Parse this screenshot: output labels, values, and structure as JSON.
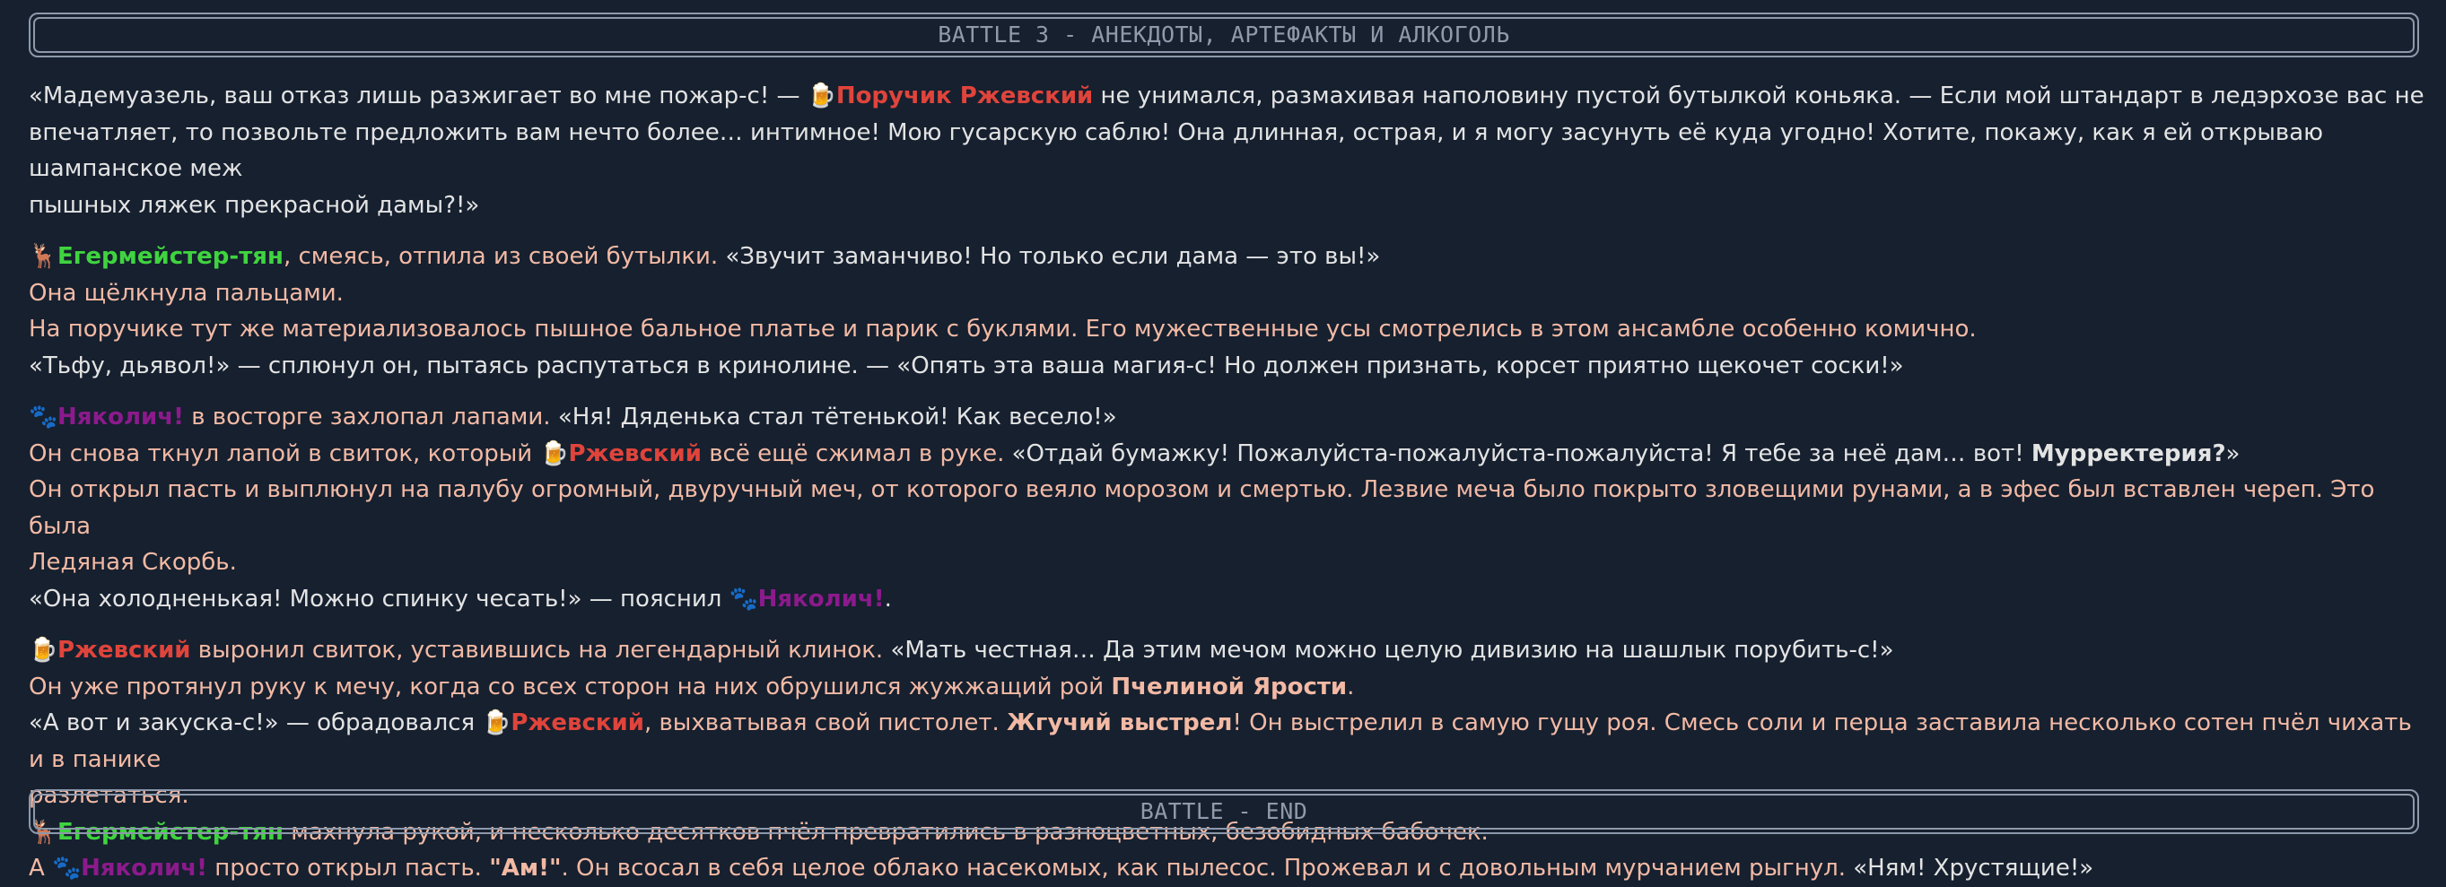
{
  "banners": {
    "top": "BATTLE 3 - АНЕКДОТЫ, АРТЕФАКТЫ И АЛКОГОЛЬ",
    "bottom": "BATTLE - END"
  },
  "characters": {
    "rzhevsky": {
      "name": "Ржевский",
      "full_name": "Поручик Ржевский",
      "icon": "beer-mug-icon",
      "glyph": "🍺",
      "color": "#e0443b"
    },
    "eger": {
      "name": "Егермейстер-тян",
      "icon": "deer-icon",
      "glyph": "🦌",
      "color": "#3fd43f"
    },
    "nyak": {
      "name": "Няколич!",
      "icon": "paw-prints-icon",
      "glyph": "🐾",
      "color": "#8c1a8c"
    }
  },
  "colors": {
    "background": "#16202f",
    "speech": "#e3e3e3",
    "narration": "#f2b9a4",
    "banner_border": "#8d99ab"
  },
  "p1": {
    "a": "«Мадемуазель, ваш отказ лишь разжигает во мне пожар-с! — ",
    "b": " не унимался, размахивая наполовину пустой бутылкой коньяка. — Если мой штандарт в ледэрхозе вас не",
    "c": "впечатляет, то позвольте предложить вам нечто более… интимное! Мою гусарскую саблю! Она длинная, острая, и я могу засунуть её куда угодно! Хотите, покажу, как я ей открываю шампанское меж",
    "d": "пышных ляжек прекрасной дамы?!»"
  },
  "p2": {
    "a": ", смеясь, отпила из своей бутылки. ",
    "b": "«Звучит заманчиво! Но только если дама — это вы!»",
    "c": "Она щёлкнула пальцами.",
    "d": "На поручике тут же материализовалось пышное бальное платье и парик с буклями. Его мужественные усы смотрелись в этом ансамбле особенно комично.",
    "e": "«Тьфу, дьявол!» — сплюнул он, пытаясь распутаться в кринолине. — «Опять эта ваша магия-с! Но должен признать, корсет приятно щекочет соски!»"
  },
  "p3": {
    "a": " в восторге захлопал лапами. ",
    "b": "«Ня! Дяденька стал тётенькой! Как весело!»",
    "c": "Он снова ткнул лапой в свиток, который ",
    "d": " всё ещё сжимал в руке. ",
    "e": "«Отдай бумажку! Пожалуйста-пожалуйста-пожалуйста! Я тебе за неё дам… вот! ",
    "f": "Мурректерия?",
    "g": "»",
    "h": "Он открыл пасть и выплюнул на палубу огромный, двуручный меч, от которого веяло морозом и смертью. Лезвие меча было покрыто зловещими рунами, а в эфес был вставлен череп. Это была",
    "i": "Ледяная Скорбь.",
    "j": "«Она холодненькая! Можно спинку чесать!» — пояснил ",
    "k": "."
  },
  "p4": {
    "a": " выронил свиток, уставившись на легендарный клинок. ",
    "b": "«Мать честная… Да этим мечом можно целую дивизию на шашлык порубить-с!»",
    "c": "Он уже протянул руку к мечу, когда со всех сторон на них обрушился жужжащий рой ",
    "d": "Пчелиной Ярости",
    "e": ".",
    "f": "«А вот и закуска-с!» — обрадовался ",
    "g": ", выхватывая свой пистолет. ",
    "h": "Жгучий выстрел",
    "i": "! Он выстрелил в самую гущу роя. Смесь соли и перца заставила несколько сотен пчёл чихать и в панике",
    "j": "разлетаться.",
    "k": " махнула рукой, и несколько десятков пчёл превратились в разноцветных, безобидных бабочек.",
    "l": "А ",
    "m": " просто открыл пасть. ",
    "n": "\"Ам!\"",
    "o": ". Он всосал в себя целое облако насекомых, как пылесос. Прожевал и с довольным мурчанием рыгнул. ",
    "p": "«Ням! Хрустящие!»"
  }
}
